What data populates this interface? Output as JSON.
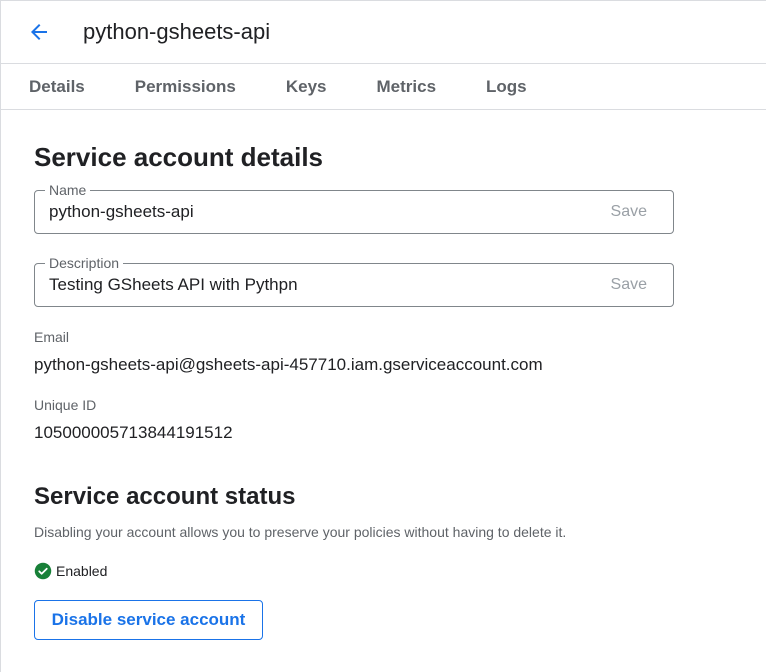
{
  "header": {
    "title": "python-gsheets-api",
    "back_icon": "arrow-back-icon"
  },
  "tabs": [
    {
      "label": "Details"
    },
    {
      "label": "Permissions"
    },
    {
      "label": "Keys"
    },
    {
      "label": "Metrics"
    },
    {
      "label": "Logs"
    }
  ],
  "details": {
    "heading": "Service account details",
    "name": {
      "label": "Name",
      "value": "python-gsheets-api",
      "save": "Save"
    },
    "description": {
      "label": "Description",
      "value": "Testing GSheets API with Pythpn",
      "save": "Save"
    },
    "email": {
      "label": "Email",
      "value": "python-gsheets-api@gsheets-api-457710.iam.gserviceaccount.com"
    },
    "unique_id": {
      "label": "Unique ID",
      "value": "105000005713844191512"
    }
  },
  "status": {
    "heading": "Service account status",
    "description": "Disabling your account allows you to preserve your policies without having to delete it.",
    "state": "Enabled",
    "state_icon": "check-circle-icon",
    "disable_button": "Disable service account"
  },
  "colors": {
    "accent": "#1a73e8",
    "success": "#188038"
  }
}
